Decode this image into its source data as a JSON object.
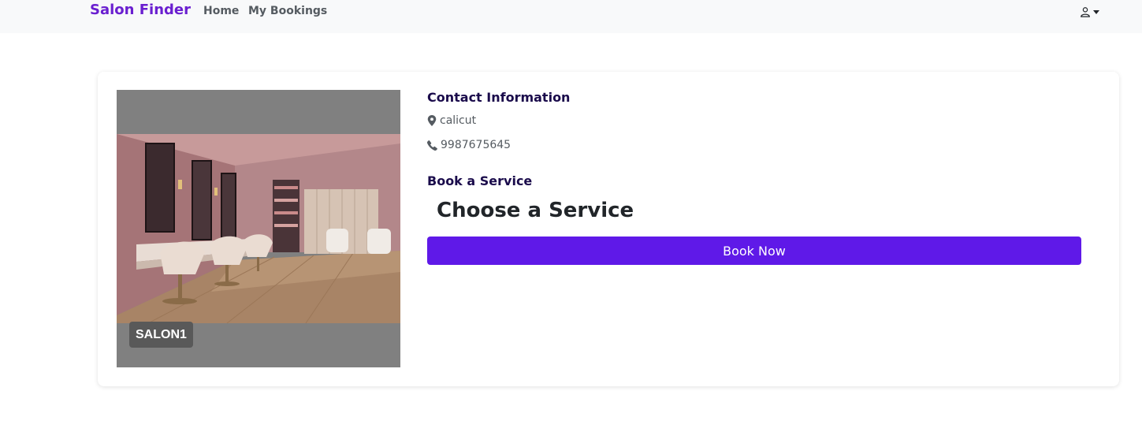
{
  "navbar": {
    "brand": "Salon Finder",
    "links": [
      {
        "label": "Home"
      },
      {
        "label": "My Bookings"
      }
    ],
    "user_menu_icon": "user-icon",
    "colors": {
      "brand": "#6a1fd0",
      "background": "#f8f9fa"
    }
  },
  "salon": {
    "name": "SALON1",
    "image_icon": "salon-interior-photo"
  },
  "contact": {
    "heading": "Contact Information",
    "location": "calicut",
    "location_icon": "map-pin-icon",
    "phone": "9987675645",
    "phone_icon": "phone-icon"
  },
  "booking": {
    "heading": "Book a Service",
    "select_label": "Choose a Service",
    "button_label": "Book Now",
    "button_color": "#5f19e8"
  }
}
